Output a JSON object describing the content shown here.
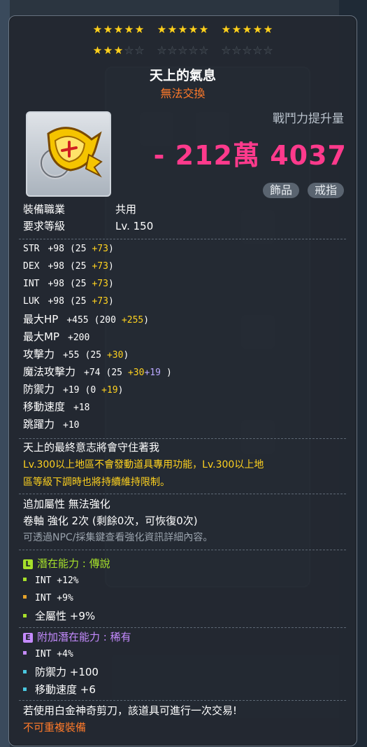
{
  "stars": {
    "groups": [
      [
        true,
        true,
        true,
        true,
        true
      ],
      [
        true,
        true,
        true,
        true,
        true
      ],
      [
        true,
        true,
        true,
        true,
        true
      ],
      [
        true,
        true,
        true,
        false,
        false
      ],
      [
        false,
        false,
        false,
        false,
        false
      ],
      [
        false,
        false,
        false,
        false,
        false
      ]
    ],
    "filled_count": 18,
    "total": 30
  },
  "item": {
    "name": "天上的氣息",
    "trade": "無法交換",
    "icon": "gold-ring-icon"
  },
  "combat": {
    "label": "戰鬥力提升量",
    "value": "- 212萬 4037"
  },
  "tags": [
    "飾品",
    "戒指"
  ],
  "requirements": {
    "job_label": "裝備職業",
    "job_value": "共用",
    "level_label": "要求等級",
    "level_value": "Lv. 150"
  },
  "stats": [
    {
      "name": "STR",
      "total": "+98",
      "base": "(25",
      "bonus": "+73",
      "bonus2": "",
      "close": ")"
    },
    {
      "name": "DEX",
      "total": "+98",
      "base": "(25",
      "bonus": "+73",
      "bonus2": "",
      "close": ")"
    },
    {
      "name": "INT",
      "total": "+98",
      "base": "(25",
      "bonus": "+73",
      "bonus2": "",
      "close": ")"
    },
    {
      "name": "LUK",
      "total": "+98",
      "base": "(25",
      "bonus": "+73",
      "bonus2": "",
      "close": ")"
    },
    {
      "name": "最大HP",
      "total": "+455",
      "base": "(200",
      "bonus": "+255",
      "bonus2": "",
      "close": ")"
    },
    {
      "name": "最大MP",
      "total": "+200",
      "base": "",
      "bonus": "",
      "bonus2": "",
      "close": ""
    },
    {
      "name": "攻擊力",
      "total": "+55",
      "base": "(25",
      "bonus": "+30",
      "bonus2": "",
      "close": ")"
    },
    {
      "name": "魔法攻擊力",
      "total": "+74",
      "base": "(25",
      "bonus": "+30",
      "bonus2": "+19",
      "close": ")"
    },
    {
      "name": "防禦力",
      "total": "+19",
      "base": "(0",
      "bonus": "+19",
      "bonus2": "",
      "close": ")"
    },
    {
      "name": "移動速度",
      "total": "+18",
      "base": "",
      "bonus": "",
      "bonus2": "",
      "close": ""
    },
    {
      "name": "跳躍力",
      "total": "+10",
      "base": "",
      "bonus": "",
      "bonus2": "",
      "close": ""
    }
  ],
  "description": {
    "flavor": "天上的最終意志將會守住著我",
    "restriction_line1": "Lv.300以上地區不會發動道具專用功能，Lv.300以上地",
    "restriction_line2": "區等級下調時也將持續維持限制。",
    "extra_attr": "追加屬性 無法強化",
    "scroll": "卷軸 強化 2次 (剩餘0次，可恢復0次)",
    "npc_hint": "可透過NPC/採集鍵查看強化資訊詳細內容。"
  },
  "potential": {
    "badge": "L",
    "title": "潛在能力 : 傳說",
    "lines": [
      "INT +12%",
      "INT +9%",
      "全屬性 +9%"
    ],
    "color": "#a6e02a"
  },
  "bonus_potential": {
    "badge": "E",
    "title": "附加潛在能力 : 稀有",
    "lines": [
      "INT +4%",
      "防禦力 +100",
      "移動速度 +6"
    ],
    "color": "#c58bff"
  },
  "footer": {
    "scissors": "若使用白金神奇剪刀，該道具可進行一次交易!",
    "unique": "不可重複裝備"
  }
}
